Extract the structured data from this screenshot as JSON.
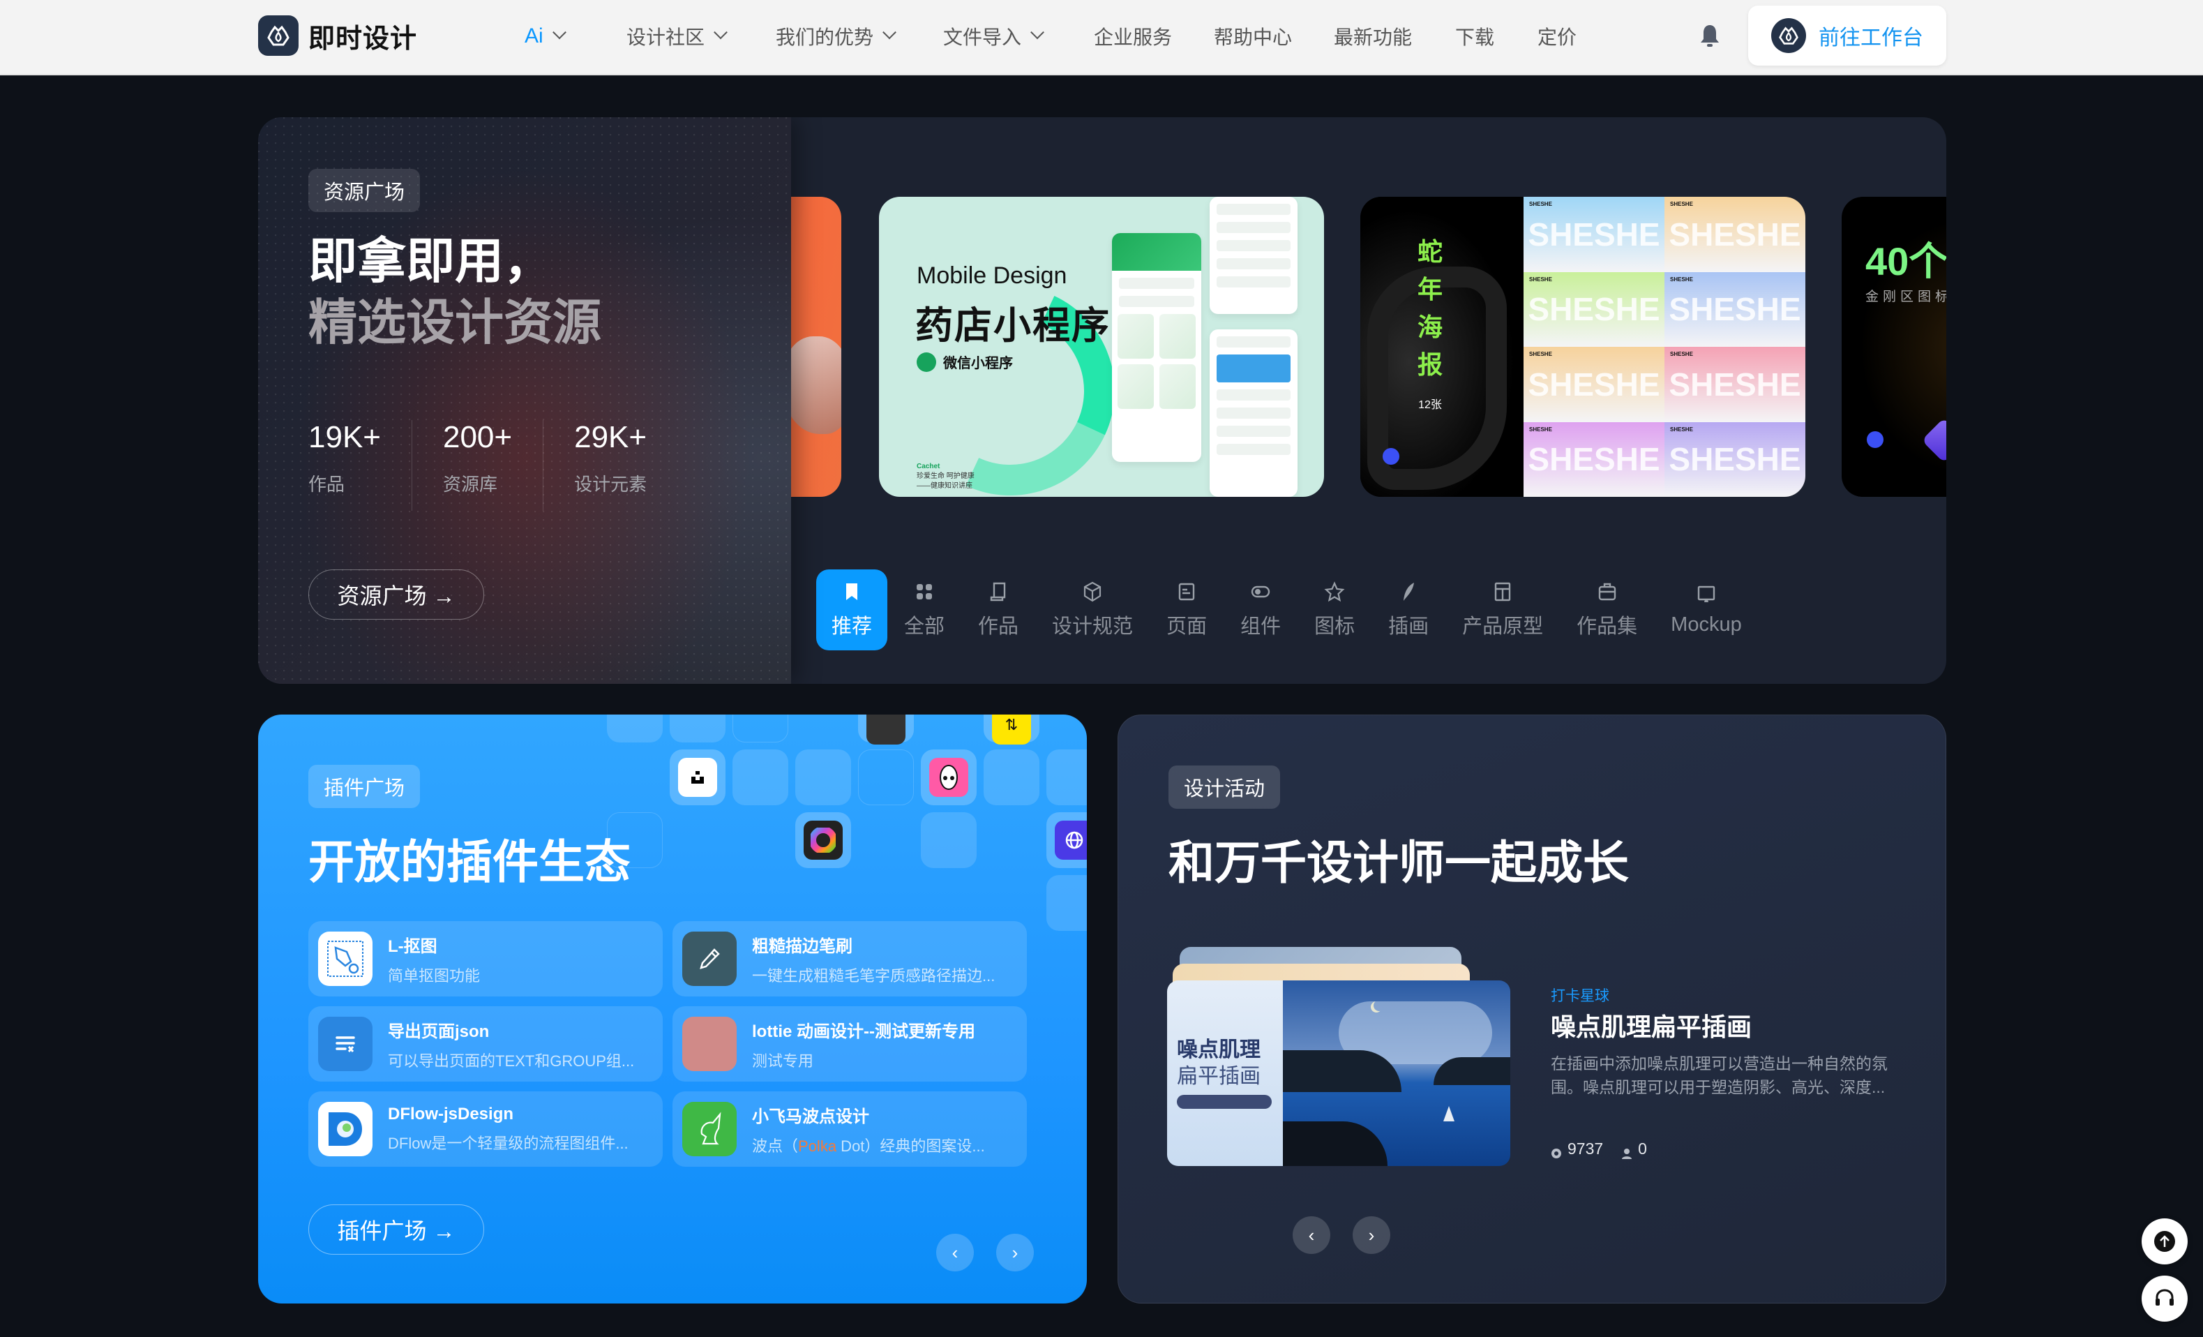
{
  "nav": {
    "brand": "即时设计",
    "items": [
      {
        "label": "Ai",
        "dropdown": true
      },
      {
        "label": "设计社区",
        "dropdown": true
      },
      {
        "label": "我们的优势",
        "dropdown": true
      },
      {
        "label": "文件导入",
        "dropdown": true
      },
      {
        "label": "企业服务",
        "dropdown": false
      },
      {
        "label": "帮助中心",
        "dropdown": false
      },
      {
        "label": "最新功能",
        "dropdown": false
      },
      {
        "label": "下载",
        "dropdown": false
      },
      {
        "label": "定价",
        "dropdown": false
      }
    ],
    "notification_icon": "bell-icon",
    "workbench_button": "前往工作台"
  },
  "hero": {
    "tag": "资源广场",
    "title_line1": "即拿即用，",
    "title_line2": "精选设计资源",
    "stats": [
      {
        "value": "19K+",
        "label": "作品"
      },
      {
        "value": "200+",
        "label": "资源库"
      },
      {
        "value": "29K+",
        "label": "设计元素"
      }
    ],
    "cta": "资源广场 →",
    "carousel": {
      "mint_card": {
        "eyebrow": "Mobile Design",
        "title": "药店小程序",
        "badge": "微信小程序",
        "small_brand": "Cachet",
        "small_line1": "珍爱生命 呵护健康",
        "small_line2": "——健康知识讲座"
      },
      "snake_card": {
        "title_chars": [
          "蛇",
          "年",
          "海",
          "报"
        ],
        "count": "12张",
        "tiles": [
          "SHESHE",
          "SHESHE",
          "SHESHE",
          "SHESHE",
          "SHESHE",
          "SHESHE",
          "SHESHE",
          "SHESHE"
        ],
        "tile_brand": "SHESHE",
        "tile_colors": [
          "#9fd6f6",
          "#f6d39c",
          "#c9f09a",
          "#a9c4f4",
          "#f6d29c",
          "#f4a2b4",
          "#dea1f0",
          "#b6a8f2"
        ]
      },
      "forty_card": {
        "number": "40个",
        "subtitle": "金刚区图标"
      }
    },
    "tabs": [
      {
        "label": "推荐",
        "icon": "bookmark-icon",
        "active": true
      },
      {
        "label": "全部",
        "icon": "grid-icon",
        "active": false
      },
      {
        "label": "作品",
        "icon": "scroll-icon",
        "active": false
      },
      {
        "label": "设计规范",
        "icon": "cube-icon",
        "active": false
      },
      {
        "label": "页面",
        "icon": "page-icon",
        "active": false
      },
      {
        "label": "组件",
        "icon": "toggle-icon",
        "active": false
      },
      {
        "label": "图标",
        "icon": "star-icon",
        "active": false
      },
      {
        "label": "插画",
        "icon": "feather-icon",
        "active": false
      },
      {
        "label": "产品原型",
        "icon": "layout-icon",
        "active": false
      },
      {
        "label": "作品集",
        "icon": "briefcase-icon",
        "active": false
      },
      {
        "label": "Mockup",
        "icon": "monitor-icon",
        "active": false
      }
    ]
  },
  "plugins": {
    "tag": "插件广场",
    "title": "开放的插件生态",
    "items": [
      {
        "name": "L-抠图",
        "desc": "简单抠图功能",
        "icon": "pen-tool-icon",
        "color": "#ffffff"
      },
      {
        "name": "粗糙描边笔刷",
        "desc": "一键生成粗糙毛笔字质感路径描边...",
        "icon": "pencil-icon",
        "color": "#3a5a66"
      },
      {
        "name": "导出页面json",
        "desc": "可以导出页面的TEXT和GROUP组...",
        "icon": "list-export-icon",
        "color": "#2a86e0"
      },
      {
        "name": "lottie 动画设计--测试更新专用",
        "desc": "测试专用",
        "icon": "blank-icon",
        "color": "#d08a88"
      },
      {
        "name": "DFlow-jsDesign",
        "desc": "DFlow是一个轻量级的流程图组件...",
        "icon": "dflow-icon",
        "color": "#ffffff"
      },
      {
        "name": "小飞马波点设计",
        "desc_prefix": "波点（",
        "desc_highlight": "Polka",
        "desc_suffix": " Dot）经典的图案设...",
        "icon": "unicorn-icon",
        "color": "#3fb845"
      }
    ],
    "cta": "插件广场 →",
    "prev": "‹",
    "next": "›"
  },
  "activity": {
    "tag": "设计活动",
    "title": "和万千设计师一起成长",
    "cover": {
      "title_bold": "噪点肌理",
      "title_light": "扁平插画"
    },
    "subtitle": "打卡星球",
    "name": "噪点肌理扁平插画",
    "description": "在插画中添加噪点肌理可以营造出一种自然的氛围。噪点肌理可以用于塑造阴影、高光、深度...",
    "views": "9737",
    "participants": "0",
    "prev": "‹",
    "next": "›"
  },
  "floating": {
    "top_button": "back-to-top",
    "support_button": "customer-support"
  },
  "colors": {
    "accent": "#0a9bff",
    "nav_bg": "#f3f3f3",
    "page_bg": "#0d1118",
    "plugin_card": "#1e95ff",
    "activity_card": "#222b3f"
  }
}
